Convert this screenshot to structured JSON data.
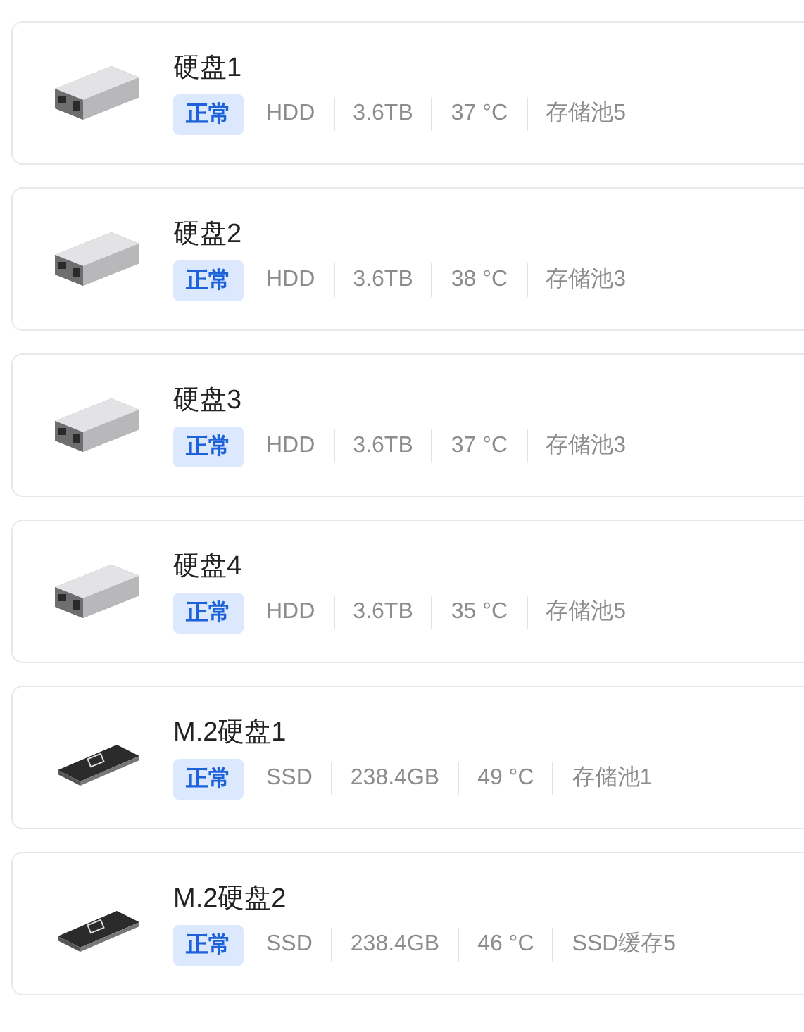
{
  "disks": [
    {
      "kind": "hdd",
      "name": "硬盘1",
      "status": "正常",
      "specs": [
        "HDD",
        "3.6TB",
        "37 °C",
        "存储池5"
      ]
    },
    {
      "kind": "hdd",
      "name": "硬盘2",
      "status": "正常",
      "specs": [
        "HDD",
        "3.6TB",
        "38 °C",
        "存储池3"
      ]
    },
    {
      "kind": "hdd",
      "name": "硬盘3",
      "status": "正常",
      "specs": [
        "HDD",
        "3.6TB",
        "37 °C",
        "存储池3"
      ]
    },
    {
      "kind": "hdd",
      "name": "硬盘4",
      "status": "正常",
      "specs": [
        "HDD",
        "3.6TB",
        "35 °C",
        "存储池5"
      ]
    },
    {
      "kind": "ssd",
      "name": "M.2硬盘1",
      "status": "正常",
      "specs": [
        "SSD",
        "238.4GB",
        "49 °C",
        "存储池1"
      ]
    },
    {
      "kind": "ssd",
      "name": "M.2硬盘2",
      "status": "正常",
      "specs": [
        "SSD",
        "238.4GB",
        "46 °C",
        "SSD缓存5"
      ]
    }
  ]
}
